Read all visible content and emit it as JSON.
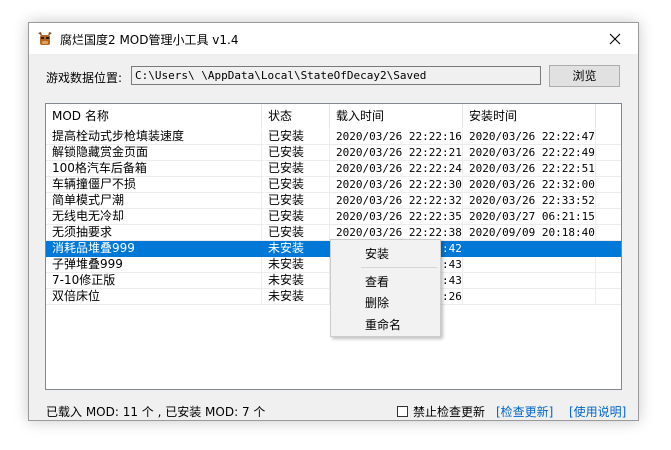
{
  "window": {
    "title": "腐烂国度2 MOD管理小工具 v1.4",
    "app_icon": "bull-head-icon"
  },
  "path": {
    "label": "游戏数据位置:",
    "value": "C:\\Users\\      \\AppData\\Local\\StateOfDecay2\\Saved",
    "browse_label": "浏览"
  },
  "table": {
    "columns": [
      "MOD 名称",
      "状态",
      "载入时间",
      "安装时间"
    ],
    "rows": [
      {
        "name": "提高栓动式步枪填装速度",
        "status": "已安装",
        "load": "2020/03/26 22:22:16",
        "install": "2020/03/26 22:22:47"
      },
      {
        "name": "解锁隐藏赏金页面",
        "status": "已安装",
        "load": "2020/03/26 22:22:21",
        "install": "2020/03/26 22:22:49"
      },
      {
        "name": "100格汽车后备箱",
        "status": "已安装",
        "load": "2020/03/26 22:22:24",
        "install": "2020/03/26 22:22:51"
      },
      {
        "name": "车辆撞僵尸不损",
        "status": "已安装",
        "load": "2020/03/26 22:22:30",
        "install": "2020/03/26 22:32:00"
      },
      {
        "name": "简单模式尸潮",
        "status": "已安装",
        "load": "2020/03/26 22:22:32",
        "install": "2020/03/26 22:33:52"
      },
      {
        "name": "无线电无冷却",
        "status": "已安装",
        "load": "2020/03/26 22:22:35",
        "install": "2020/03/27 06:21:15"
      },
      {
        "name": "无须抽要求",
        "status": "已安装",
        "load": "2020/03/26 22:22:38",
        "install": "2020/09/09 20:18:40"
      },
      {
        "name": "消耗品堆叠999",
        "status": "未安装",
        "load": "2020/03/26 22:22:42",
        "install": ""
      },
      {
        "name": "子弹堆叠999",
        "status": "未安装",
        "load": "2020/03/26 22:22:43",
        "install": ""
      },
      {
        "name": "7-10修正版",
        "status": "未安装",
        "load": "2020/03/26 22:22:43",
        "install": ""
      },
      {
        "name": "双倍床位",
        "status": "未安装",
        "load": "2020/03/26 22:22:26",
        "install": ""
      }
    ]
  },
  "context_menu": {
    "items": [
      "安装",
      "查看",
      "删除",
      "重命名"
    ]
  },
  "status_bar": {
    "summary": "已载入 MOD: 11 个 , 已安装 MOD: 7 个",
    "disable_check_label": "禁止检查更新",
    "check_update_link": "[检查更新]",
    "help_link": "[使用说明]"
  },
  "colors": {
    "selection": "#0078d7",
    "link": "#0066cc",
    "window_bg": "#f0f0f0"
  }
}
